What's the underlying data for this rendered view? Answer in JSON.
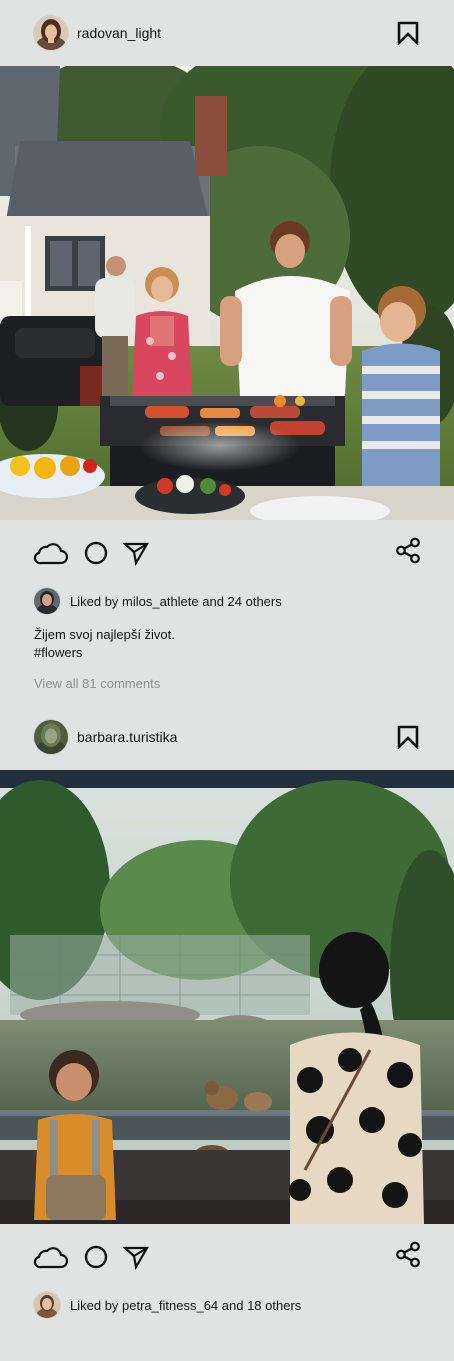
{
  "posts": [
    {
      "username": "radovan_light",
      "likes_text": "Liked by milos_athlete and 24 others",
      "caption_line1": "Žijem svoj najlepší život.",
      "caption_line2": "#flowers",
      "view_comments": "View all 81 comments",
      "image": "family-barbecue-photo"
    },
    {
      "username": "barbara.turistika",
      "likes_text": "Liked by petra_fitness_64 and 18 others",
      "image": "zoo-monkeys-photo"
    }
  ],
  "icons": {
    "bookmark": "bookmark-icon",
    "like": "cloud-icon",
    "comment": "circle-icon",
    "send": "send-icon",
    "share": "share-icon"
  },
  "colors": {
    "background": "#e1e3e2",
    "text": "#141414",
    "muted": "#8e918f"
  }
}
